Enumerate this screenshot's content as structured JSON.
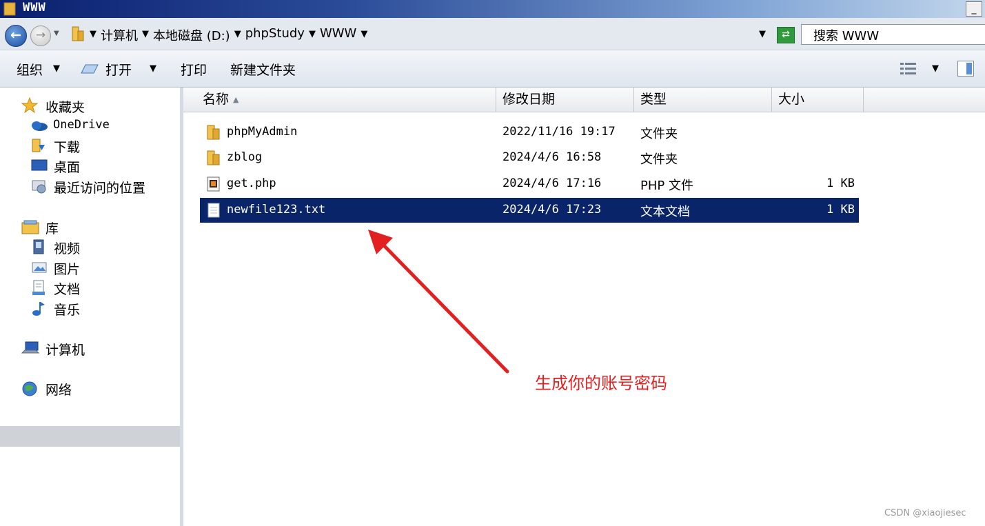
{
  "window": {
    "title": "WWW",
    "minimize_label": "_"
  },
  "address_bar": {
    "breadcrumbs": [
      "计算机",
      "本地磁盘 (D:)",
      "phpStudy",
      "WWW"
    ],
    "search_placeholder": "搜索 WWW"
  },
  "toolbar": {
    "organize": "组织",
    "open": "打开",
    "print": "打印",
    "new_folder": "新建文件夹"
  },
  "sidebar": {
    "favorites": {
      "label": "收藏夹",
      "items": [
        "OneDrive",
        "下载",
        "桌面",
        "最近访问的位置"
      ]
    },
    "libraries": {
      "label": "库",
      "items": [
        "视频",
        "图片",
        "文档",
        "音乐"
      ]
    },
    "computer": "计算机",
    "network": "网络"
  },
  "columns": {
    "name": "名称",
    "modified": "修改日期",
    "type": "类型",
    "size": "大小"
  },
  "files": [
    {
      "name": "phpMyAdmin",
      "modified": "2022/11/16 19:17",
      "type": "文件夹",
      "size": "",
      "icon": "folder-icon"
    },
    {
      "name": "zblog",
      "modified": "2024/4/6 16:58",
      "type": "文件夹",
      "size": "",
      "icon": "folder-icon"
    },
    {
      "name": "get.php",
      "modified": "2024/4/6 17:16",
      "type": "PHP 文件",
      "size": "1 KB",
      "icon": "php-file-icon"
    },
    {
      "name": "newfile123.txt",
      "modified": "2024/4/6 17:23",
      "type": "文本文档",
      "size": "1 KB",
      "icon": "text-file-icon",
      "selected": true
    }
  ],
  "annotation": {
    "text": "生成你的账号密码",
    "color": "#e32020"
  },
  "watermark": "CSDN @xiaojiesec",
  "colors": {
    "selection": "#0a246a",
    "title_gradient_start": "#0a1f6e",
    "nav_hover": "#cfd3d8"
  }
}
